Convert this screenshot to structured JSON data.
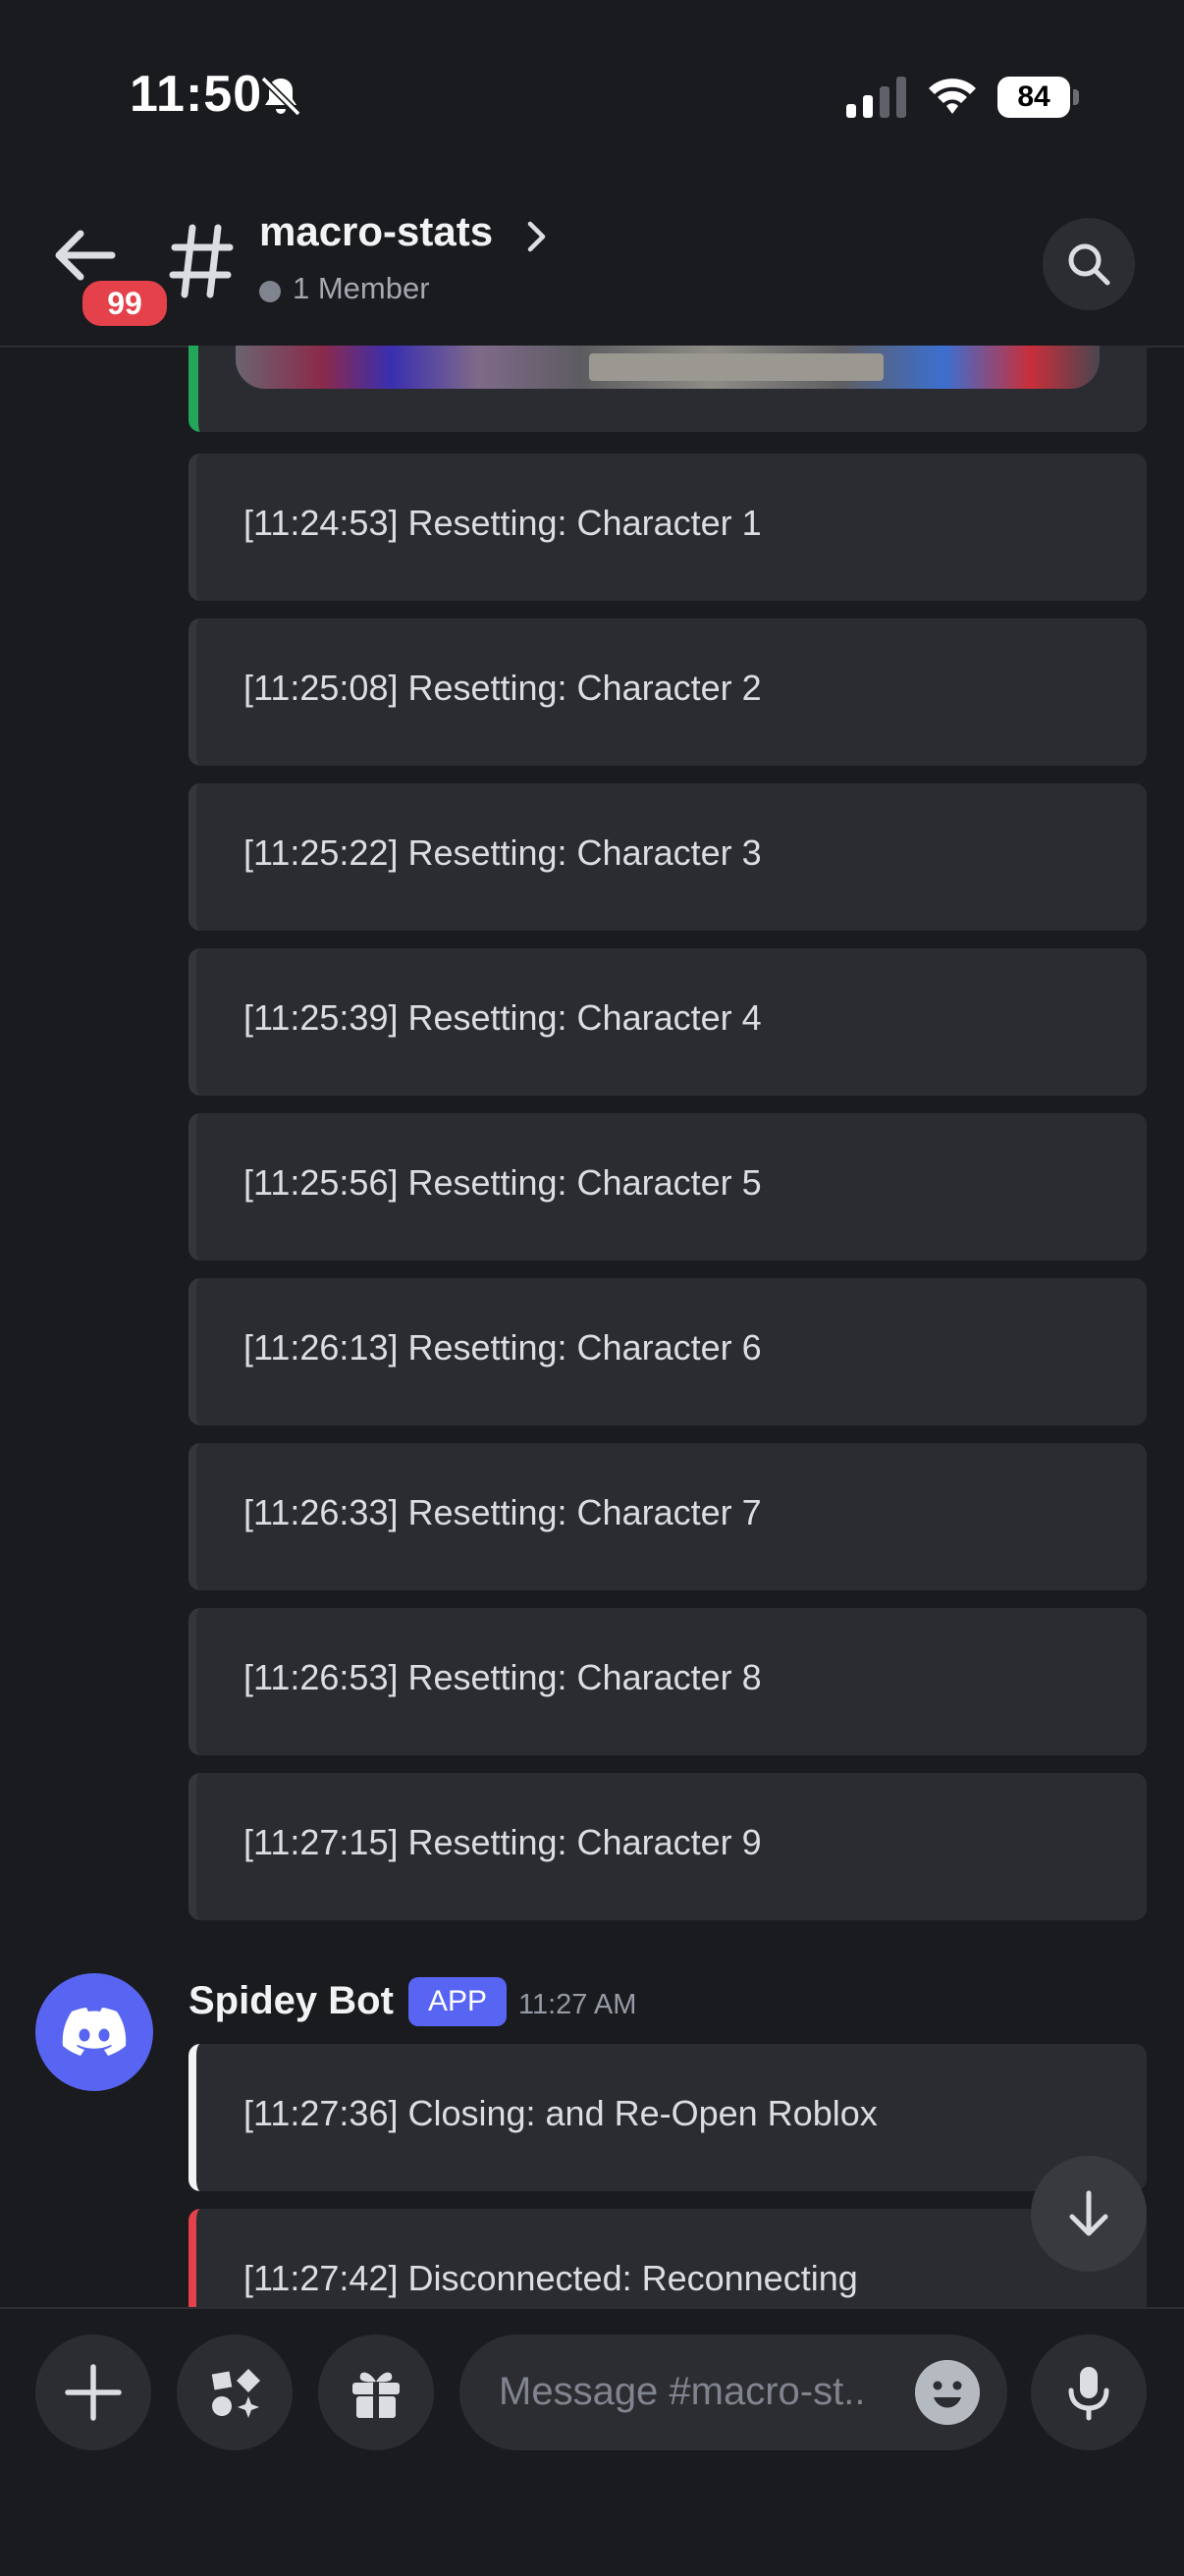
{
  "status_bar": {
    "time": "11:50",
    "battery": "84"
  },
  "header": {
    "unread_badge": "99",
    "channel_name": "macro-stats",
    "member_count": "1 Member"
  },
  "messages": [
    {
      "text": "[11:24:53] Resetting: Character 1"
    },
    {
      "text": "[11:25:08] Resetting: Character 2"
    },
    {
      "text": "[11:25:22] Resetting: Character 3"
    },
    {
      "text": "[11:25:39] Resetting: Character 4"
    },
    {
      "text": "[11:25:56] Resetting: Character 5"
    },
    {
      "text": "[11:26:13] Resetting: Character 6"
    },
    {
      "text": "[11:26:33] Resetting: Character 7"
    },
    {
      "text": "[11:26:53] Resetting: Character 8"
    },
    {
      "text": "[11:27:15] Resetting: Character 9"
    }
  ],
  "bot_message": {
    "author": "Spidey Bot",
    "tag": "APP",
    "time": "11:27 AM",
    "embeds": [
      {
        "text": "[11:27:36] Closing: and Re-Open Roblox",
        "accent": "#f2f3f5"
      },
      {
        "text": "[11:27:42] Disconnected: Reconnecting",
        "accent": "#e5414b"
      }
    ]
  },
  "composer": {
    "placeholder": "Message #macro-st.."
  },
  "colors": {
    "background": "#1a1b1f",
    "embed": "#2b2c32",
    "blurple": "#5865f2",
    "badge_red": "#e5414b",
    "image_accent": "#23a55a"
  },
  "icons": [
    "bell-slash-icon",
    "signal-icon",
    "wifi-icon",
    "back-arrow-icon",
    "hash-icon",
    "chevron-right-icon",
    "search-icon",
    "discord-logo-icon",
    "arrow-down-icon",
    "plus-icon",
    "apps-icon",
    "gift-icon",
    "emoji-icon",
    "microphone-icon"
  ]
}
